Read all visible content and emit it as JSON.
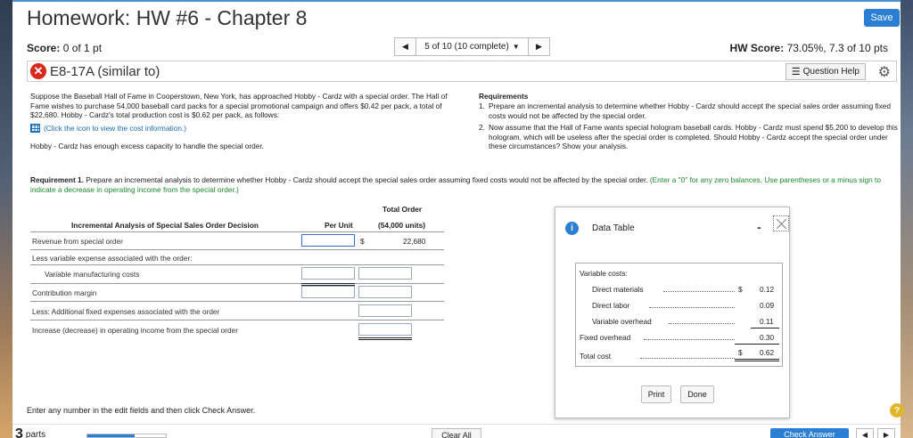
{
  "header": {
    "title": "Homework: HW #6 - Chapter 8",
    "save_label": "Save"
  },
  "score": {
    "label": "Score:",
    "value": "0 of 1 pt"
  },
  "nav": {
    "position": "5 of 10 (10 complete)",
    "prev_icon": "triangle-left",
    "next_icon": "triangle-right",
    "dropdown_icon": "triangle-down"
  },
  "hw_score": {
    "label": "HW Score:",
    "value": "73.05%, 7.3 of 10 pts"
  },
  "question": {
    "status_icon": "x-circle",
    "id": "E8-17A (similar to)",
    "help_label": "Question Help",
    "help_icon": "list-icon",
    "settings_icon": "gear"
  },
  "problem": {
    "text": "Suppose the Baseball Hall of Fame in Cooperstown, New York, has approached Hobby - Cardz with a special order. The Hall of Fame wishes to purchase 54,000 baseball card packs for a special promotional campaign and offers $0.42 per pack, a total of $22,680. Hobby - Cardz's total production cost is $0.62 per pack, as follows:",
    "link": "(Click the icon to view the cost information.)",
    "capacity": "Hobby - Cardz has enough excess capacity to handle the special order."
  },
  "requirements": {
    "title": "Requirements",
    "items": [
      {
        "num": "1.",
        "text": "Prepare an incremental analysis to determine whether Hobby - Cardz should accept the special sales order assuming fixed costs would not be affected by the special order."
      },
      {
        "num": "2.",
        "text": "Now assume that the Hall of Fame wants special hologram baseball cards. Hobby - Cardz must spend $5,200 to develop this hologram, which will be useless after the special order is completed. Should Hobby - Cardz accept the special order under these circumstances? Show your analysis."
      }
    ]
  },
  "req1": {
    "bold": "Requirement 1.",
    "text": " Prepare an incremental analysis to determine whether Hobby - Cardz should accept the special sales order assuming fixed costs would not be affected by the special order.",
    "green": " (Enter a \"0\" for any zero balances. Use parentheses or a minus sign to indicate a decrease in operating income from the special order.)"
  },
  "analysis": {
    "total_order": "Total Order",
    "title": "Incremental Analysis of Special Sales Order Decision",
    "per_unit": "Per Unit",
    "units": "(54,000 units)",
    "rows": {
      "revenue": "Revenue from special order",
      "less_variable": "Less variable expense associated with the order:",
      "variable_mfg": "Variable manufacturing costs",
      "contribution": "Contribution margin",
      "fixed": "Less: Additional fixed expenses associated with the order",
      "operating": "Increase (decrease) in operating income from the special order"
    },
    "revenue_dollar": "$",
    "revenue_total": "22,680"
  },
  "data_table": {
    "title": "Data Table",
    "minimize": "-",
    "variable_costs": "Variable costs:",
    "direct_materials": "Direct materials",
    "dm_dollar": "$",
    "dm_value": "0.12",
    "direct_labor": "Direct labor",
    "dl_value": "0.09",
    "variable_overhead": "Variable overhead",
    "vo_value": "0.11",
    "fixed_overhead": "Fixed overhead",
    "fo_value": "0.30",
    "total_cost": "Total cost",
    "tc_dollar": "$",
    "tc_value": "0.62",
    "print_label": "Print",
    "done_label": "Done"
  },
  "footer": {
    "instruction": "Enter any number in the edit fields and then click Check Answer.",
    "help_icon": "?",
    "parts_num": "3",
    "parts_label": "parts",
    "progress_fraction": 0.6,
    "clear_all": "Clear All",
    "check_answer": "Check Answer"
  }
}
